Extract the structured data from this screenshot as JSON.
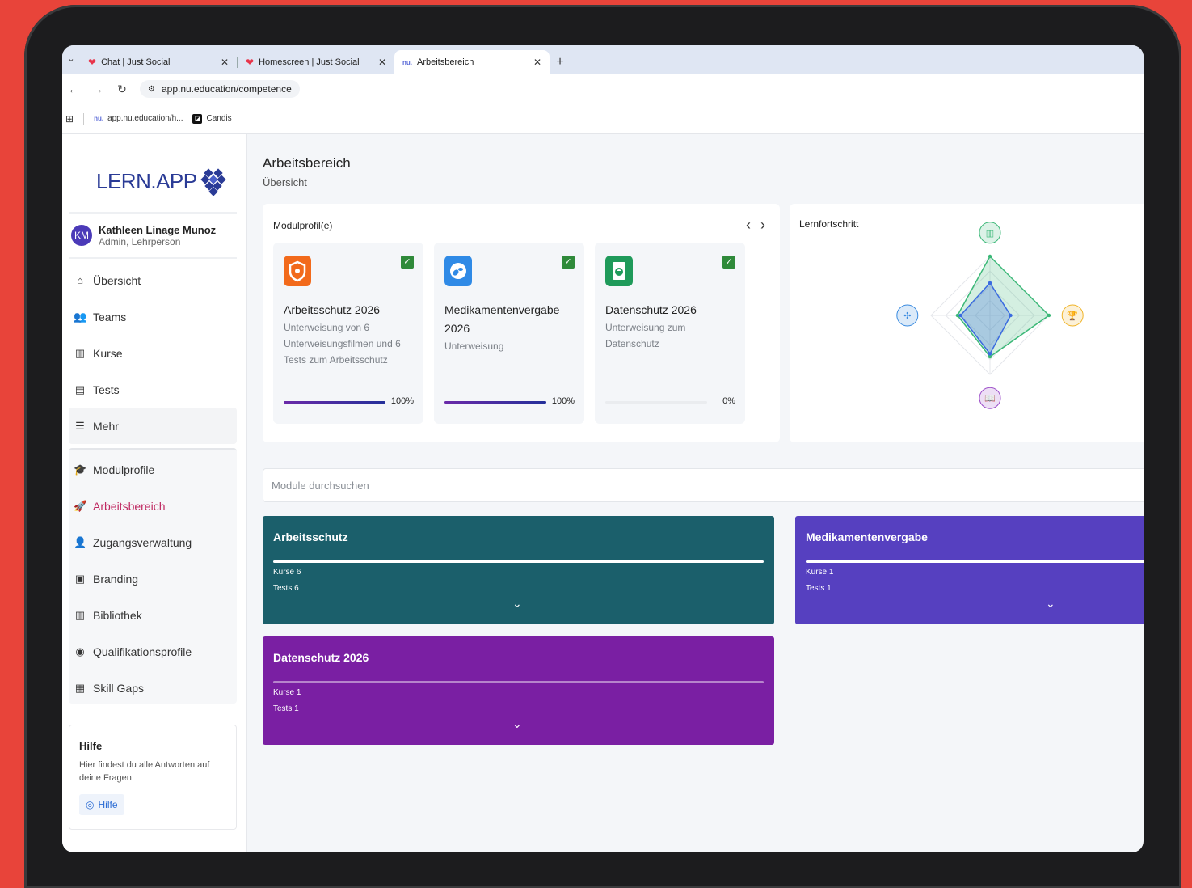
{
  "browser": {
    "tabs": [
      {
        "label": "Chat | Just Social",
        "icon": "heart-icon"
      },
      {
        "label": "Homescreen | Just Social",
        "icon": "heart-icon"
      },
      {
        "label": "Arbeitsbereich",
        "icon": "nu-icon"
      }
    ],
    "url": "app.nu.education/competence",
    "bookmarks": [
      {
        "label": "app.nu.education/h...",
        "icon": "nu-icon"
      },
      {
        "label": "Candis",
        "icon": "candis-icon"
      }
    ]
  },
  "logo": "LERN.APP",
  "user": {
    "initials": "KM",
    "name": "Kathleen Linage Munoz",
    "role": "Admin, Lehrperson"
  },
  "nav": [
    {
      "label": "Übersicht",
      "icon": "home-icon"
    },
    {
      "label": "Teams",
      "icon": "users-icon"
    },
    {
      "label": "Kurse",
      "icon": "book-icon"
    },
    {
      "label": "Tests",
      "icon": "test-icon"
    },
    {
      "label": "Mehr",
      "icon": "menu-icon"
    },
    {
      "label": "Modulprofile",
      "icon": "graduation-icon"
    },
    {
      "label": "Arbeitsbereich",
      "icon": "rocket-icon",
      "active": true
    },
    {
      "label": "Zugangsverwaltung",
      "icon": "user-access-icon"
    },
    {
      "label": "Branding",
      "icon": "branding-icon"
    },
    {
      "label": "Bibliothek",
      "icon": "library-icon"
    },
    {
      "label": "Qualifikationsprofile",
      "icon": "qualification-icon"
    },
    {
      "label": "Skill Gaps",
      "icon": "skill-gaps-icon"
    }
  ],
  "help": {
    "title": "Hilfe",
    "text": "Hier findest du alle Antworten auf deine Fragen",
    "button": "Hilfe"
  },
  "page": {
    "title": "Arbeitsbereich",
    "subtitle": "Übersicht"
  },
  "modulprofile": {
    "title": "Modulprofil(e)",
    "cards": [
      {
        "title": "Arbeitsschutz 2026",
        "desc": "Unterweisung von 6 Unterweisungsfilmen und 6 Tests zum Arbeitsschutz",
        "progress": 100,
        "progress_label": "100%",
        "icon": "shield-icon",
        "color": "#f26a1b"
      },
      {
        "title": "Medikamentenvergabe 2026",
        "desc": "Unterweisung",
        "progress": 100,
        "progress_label": "100%",
        "icon": "pills-icon",
        "color": "#2f8ae6"
      },
      {
        "title": "Datenschutz 2026",
        "desc": "Unterweisung zum Datenschutz",
        "progress": 0,
        "progress_label": "0%",
        "icon": "document-lock-icon",
        "color": "#1f9a5a"
      }
    ]
  },
  "lernfortschritt": {
    "title": "Lernfortschritt",
    "axes": [
      {
        "icon": "chart-icon",
        "color": "#3cb878"
      },
      {
        "icon": "trophy-icon",
        "color": "#f0b429"
      },
      {
        "icon": "book-open-icon",
        "color": "#9b4bc8"
      },
      {
        "icon": "puzzle-icon",
        "color": "#3a8be0"
      }
    ],
    "series": [
      {
        "values": [
          1.0,
          1.0,
          0.7,
          0.55
        ],
        "color": "#3cb878"
      },
      {
        "values": [
          0.55,
          0.35,
          0.65,
          0.5
        ],
        "color": "#3a6be0"
      }
    ]
  },
  "search": {
    "placeholder": "Module durchsuchen"
  },
  "modules": [
    {
      "title": "Arbeitsschutz",
      "kurse": "Kurse 6",
      "tests": "Tests 6",
      "color": "#1b5f6b"
    },
    {
      "title": "Medikamentenvergabe",
      "kurse": "Kurse 1",
      "tests": "Tests 1",
      "color": "#5640c0"
    },
    {
      "title": "Datenschutz 2026",
      "kurse": "Kurse 1",
      "tests": "Tests 1",
      "color": "#7a1fa3"
    }
  ]
}
